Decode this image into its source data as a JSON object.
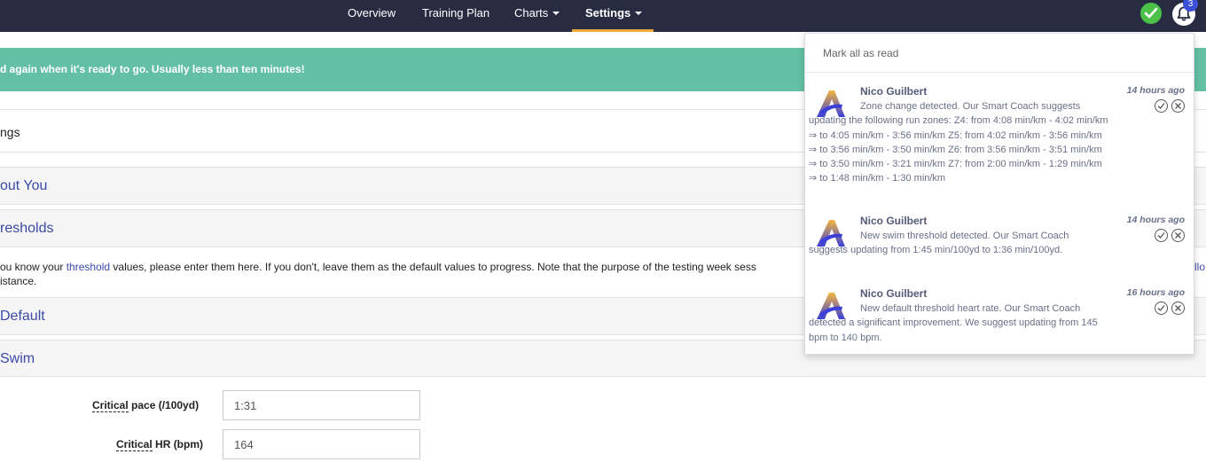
{
  "nav": {
    "items": [
      {
        "label": "Overview"
      },
      {
        "label": "Training Plan"
      },
      {
        "label": "Charts"
      },
      {
        "label": "Settings"
      }
    ],
    "badge_count": "3",
    "accent_color": "#f0a93b",
    "status_color": "#4cc14a"
  },
  "banner": {
    "text": "d again when it's ready to go. Usually less than ten minutes!",
    "color": "#64c0a4"
  },
  "page": {
    "title": "ngs"
  },
  "sections": {
    "about": "out You",
    "thresholds": "resholds",
    "default": "Default",
    "swim": "Swim"
  },
  "thresholds_info": {
    "pre": "ou know your ",
    "link": "threshold",
    "post": " values, please enter them here. If you don't, leave them as the default values to progress. Note that the purpose of the testing week sess",
    "line2": "istance.",
    "tail": "llo"
  },
  "form": {
    "critical_pace": {
      "label_underlined": "Critical",
      "label_rest": " pace (/100yd)",
      "value": "1:31"
    },
    "critical_hr": {
      "label_underlined": "Critical",
      "label_rest": " HR (bpm)",
      "value": "164"
    }
  },
  "notifications": {
    "mark_all_label": "Mark all as read",
    "items": [
      {
        "sender": "Nico Guilbert",
        "time": "14 hours ago",
        "message": "Zone change detected. Our Smart Coach suggests updating the following run zones: Z4: from 4:08 min/km - 4:02 min/km ⇒ to 4:05 min/km - 3:56 min/km Z5: from 4:02 min/km - 3:56 min/km ⇒ to 3:56 min/km - 3:50 min/km Z6: from 3:56 min/km - 3:51 min/km ⇒ to 3:50 min/km - 3:21 min/km Z7: from 2:00 min/km - 1:29 min/km ⇒ to 1:48 min/km - 1:30 min/km"
      },
      {
        "sender": "Nico Guilbert",
        "time": "14 hours ago",
        "message": "New swim threshold detected. Our Smart Coach suggests updating from 1:45 min/100yd to 1:36 min/100yd."
      },
      {
        "sender": "Nico Guilbert",
        "time": "16 hours ago",
        "message": "New default threshold heart rate. Our Smart Coach detected a significant improvement. We suggest updating from 145 bpm to 140 bpm."
      }
    ]
  }
}
